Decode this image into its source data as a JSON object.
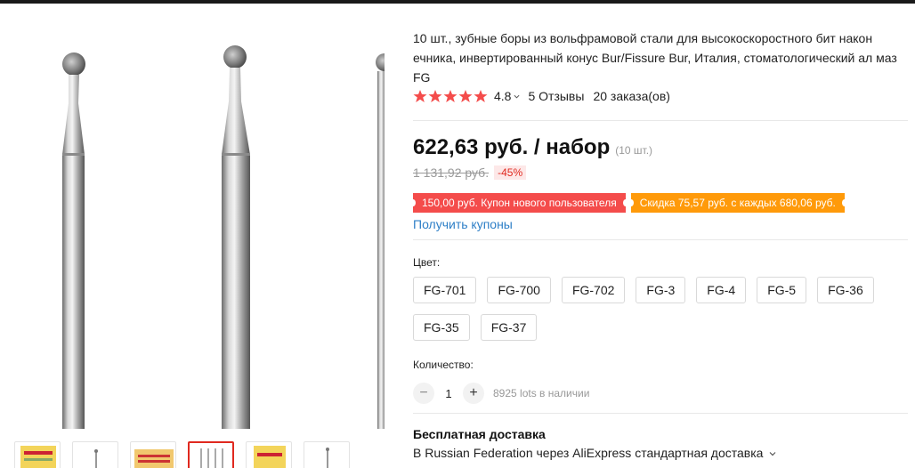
{
  "product": {
    "title": "10 шт., зубные боры из вольфрамовой стали для высокоскоростного бит након ечника, инвертированный конус Bur/Fissure Bur, Италия, стоматологический ал маз FG",
    "rating": "4.8",
    "stars": 5,
    "reviews": "5 Отзывы",
    "orders": "20 заказа(ов)"
  },
  "price": {
    "current": "622,63 руб. / набор",
    "unit": "(10 шт.)",
    "old": "1 131,92 руб.",
    "discount": "-45%"
  },
  "coupons": {
    "new_user": "150,00 руб. Купон нового пользователя",
    "store": "Скидка 75,57 руб. с каждых 680,06 руб.",
    "get_link": "Получить купоны"
  },
  "variants": {
    "label": "Цвет:",
    "options": [
      "FG-701",
      "FG-700",
      "FG-702",
      "FG-3",
      "FG-4",
      "FG-5",
      "FG-36",
      "FG-35",
      "FG-37"
    ]
  },
  "quantity": {
    "label": "Количество:",
    "value": "1",
    "minus": "−",
    "plus": "+",
    "stock": "8925 lots в наличии"
  },
  "shipping": {
    "title": "Бесплатная доставка",
    "detail": "В Russian Federation через AliExpress стандартная доставка"
  },
  "colors": {
    "star": "#f44c4b",
    "coupon_red": "#f44c4b",
    "coupon_orange": "#ff9a0a",
    "link": "#2e7fc7",
    "thumb_active_border": "#e0291f"
  },
  "icons": {
    "star": "star-icon",
    "chevron": "chevron-down-icon"
  }
}
